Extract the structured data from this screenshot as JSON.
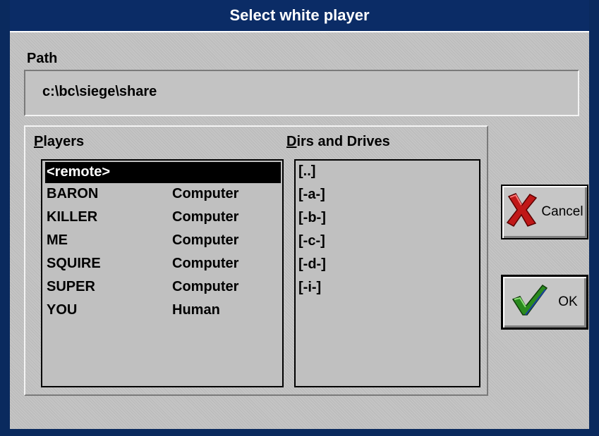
{
  "window": {
    "title": "Select white player"
  },
  "path": {
    "label": "Path",
    "value": "c:\\bc\\siege\\share"
  },
  "players": {
    "caption_access": "P",
    "caption_rest": "layers",
    "items": [
      {
        "name": "<remote>",
        "type": ""
      },
      {
        "name": "BARON",
        "type": "Computer"
      },
      {
        "name": "KILLER",
        "type": "Computer"
      },
      {
        "name": "ME",
        "type": "Computer"
      },
      {
        "name": "SQUIRE",
        "type": "Computer"
      },
      {
        "name": "SUPER",
        "type": "Computer"
      },
      {
        "name": "YOU",
        "type": "Human"
      }
    ],
    "selected_index": 0
  },
  "dirs": {
    "caption_access": "D",
    "caption_rest": "irs and Drives",
    "items": [
      "[..]",
      "[-a-]",
      "[-b-]",
      "[-c-]",
      "[-d-]",
      "[-i-]"
    ]
  },
  "buttons": {
    "cancel_label": "Cancel",
    "cancel_icon": "red-x-icon",
    "ok_label": "OK",
    "ok_icon": "green-checkmark-icon"
  },
  "colors": {
    "titlebar": "#0b2c66",
    "selection": "#000000",
    "cancel_x": "#c01818",
    "ok_check": "#2a8a1e"
  }
}
